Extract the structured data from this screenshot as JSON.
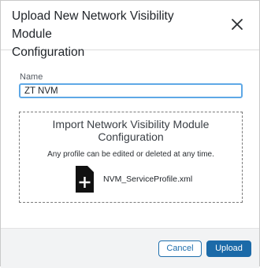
{
  "dialog": {
    "title_line1": "Upload New Network Visibility Module",
    "title_line2": "Configuration"
  },
  "form": {
    "name_label": "Name",
    "name_value": "ZT NVM"
  },
  "dropzone": {
    "title_line1": "Import Network Visibility Module",
    "title_line2": "Configuration",
    "subtitle": "Any profile can be edited or deleted at any time.",
    "file_icon": "file-add-icon",
    "file_name": "NVM_ServiceProfile.xml"
  },
  "footer": {
    "cancel_label": "Cancel",
    "upload_label": "Upload"
  },
  "colors": {
    "primary": "#1b6aa8",
    "input_focus_border": "#5ea8e6",
    "footer_bg": "#f2f3f4"
  }
}
